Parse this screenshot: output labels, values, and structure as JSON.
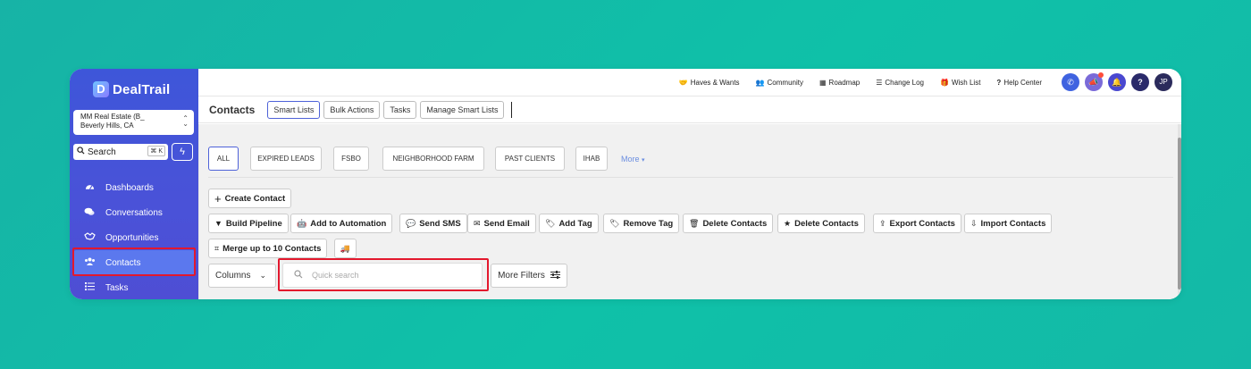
{
  "brand": {
    "name": "DealTrail",
    "mark": "D"
  },
  "account": {
    "name": "MM Real Estate (B_",
    "location": "Beverly Hills, CA"
  },
  "sidebar_search": {
    "label": "Search",
    "shortcut": "⌘ K"
  },
  "sidebar": {
    "items": [
      {
        "label": "Dashboards",
        "icon": "gauge-icon"
      },
      {
        "label": "Conversations",
        "icon": "chat-icon"
      },
      {
        "label": "Opportunities",
        "icon": "handshake-icon"
      },
      {
        "label": "Contacts",
        "icon": "users-icon"
      },
      {
        "label": "Tasks",
        "icon": "list-icon"
      }
    ]
  },
  "topbar": {
    "links": [
      "Haves & Wants",
      "Community",
      "Roadmap",
      "Change Log",
      "Wish List",
      "Help Center"
    ],
    "avatar_initials": "JP"
  },
  "header": {
    "title": "Contacts",
    "tabs": [
      "Smart Lists",
      "Bulk Actions",
      "Tasks",
      "Manage Smart Lists"
    ]
  },
  "smart_lists": {
    "chips": [
      "ALL",
      "EXPIRED LEADS",
      "FSBO",
      "NEIGHBORHOOD FARM",
      "PAST CLIENTS",
      "IHAB"
    ],
    "more": "More"
  },
  "actions": {
    "create_contact": "Create Contact",
    "row2": [
      "Build Pipeline",
      "Add to Automation",
      "Send SMS",
      "Send Email",
      "Add Tag",
      "Remove Tag",
      "Delete Contacts",
      "Delete Contacts",
      "Export Contacts",
      "Import Contacts"
    ],
    "merge": "Merge up to 10 Contacts"
  },
  "filters": {
    "columns": "Columns",
    "quick_search_placeholder": "Quick search",
    "more_filters": "More Filters"
  },
  "colors": {
    "accent": "#4e62d8",
    "highlight": "#e3182d",
    "background": "#14b9a7"
  }
}
